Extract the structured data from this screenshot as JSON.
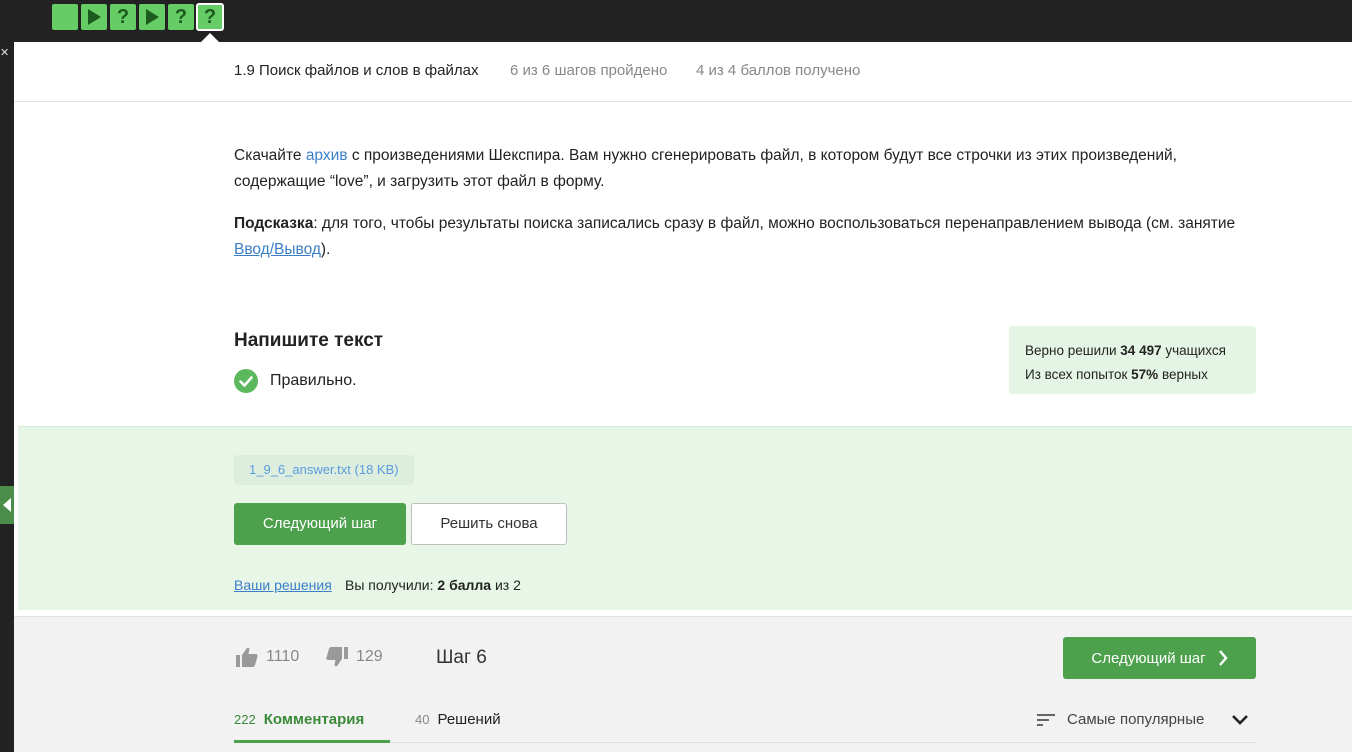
{
  "topbar": {
    "steps": [
      {
        "type": "text",
        "label": ""
      },
      {
        "type": "video",
        "label": ""
      },
      {
        "type": "quiz",
        "label": "?"
      },
      {
        "type": "video",
        "label": ""
      },
      {
        "type": "quiz",
        "label": "?"
      },
      {
        "type": "quiz",
        "label": "?",
        "active": true
      }
    ]
  },
  "lesson": {
    "title": "1.9 Поиск файлов и слов в файлах",
    "steps_progress": "6 из 6 шагов пройдено",
    "score": "4 из 4 баллов  получено"
  },
  "content": {
    "p1_before": "Скачайте ",
    "p1_link": "архив",
    "p1_after": " с произведениями Шекспира. Вам нужно сгенерировать файл, в котором будут все строчки из этих произведений, содержащие “love”, и загрузить этот файл в форму.",
    "hint_label": "Подсказка",
    "p2_text": ": для того, чтобы результаты поиска записались сразу в файл, можно воспользоваться перенаправлением вывода (см. занятие ",
    "p2_link": "Ввод/Вывод",
    "p2_end": ")."
  },
  "task": {
    "title": "Напишите текст",
    "status": "Правильно."
  },
  "stats": {
    "solved_prefix": "Верно решили ",
    "solved_count": "34 497",
    "solved_suffix": " учащихся",
    "attempts_prefix": "Из всех попыток ",
    "attempts_percent": "57%",
    "attempts_suffix": " верных"
  },
  "answer": {
    "file": "1_9_6_answer.txt (18 KB)",
    "next_label": "Следующий шаг",
    "retry_label": "Решить снова",
    "solutions_link": "Ваши решения",
    "got_prefix": "Вы получили: ",
    "got_points": "2 балла",
    "got_suffix": " из 2"
  },
  "footer": {
    "likes": "1110",
    "dislikes": "129",
    "step_label": "Шаг 6",
    "next_label": "Следующий шаг",
    "tabs": [
      {
        "count": "222",
        "label": "Комментария"
      },
      {
        "count": "40",
        "label": "Решений"
      }
    ],
    "sort_label": "Самые популярные"
  },
  "colors": {
    "accent_green": "#4da14d",
    "step_green": "#66cc66",
    "link_blue": "#3a7fc8",
    "answer_bg": "#e8f6e8"
  }
}
